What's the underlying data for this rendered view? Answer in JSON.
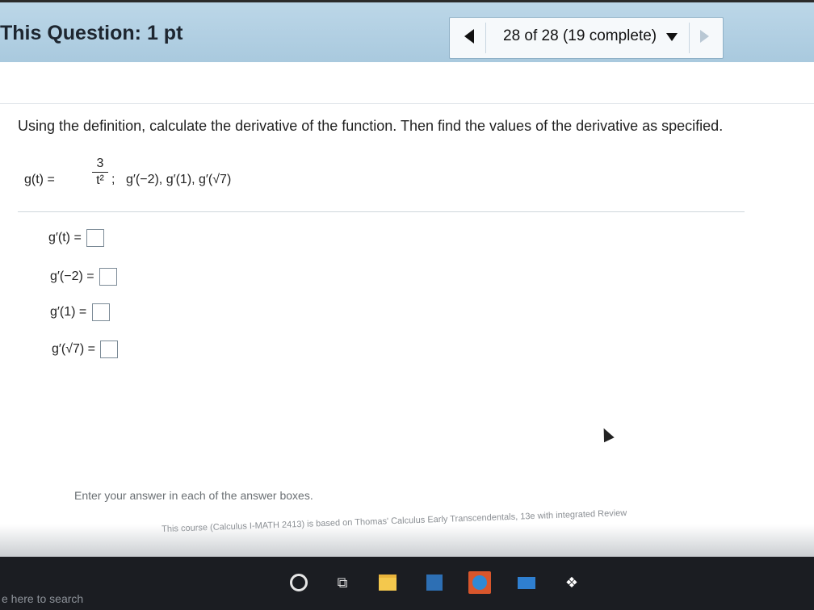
{
  "header": {
    "question_points": "This Question: 1 pt",
    "nav_status": "28 of 28 (19 complete)",
    "prev_icon": "triangle-left",
    "next_icon": "triangle-right",
    "dropdown_icon": "triangle-down"
  },
  "question": {
    "instruction": "Using the definition, calculate the derivative of the function. Then find the values of the derivative as specified.",
    "function_lhs": "g(t) =",
    "fraction_numerator": "3",
    "fraction_denominator": "t²",
    "semicolon": ";",
    "evaluations": "g′(−2), g′(1), g′(√7)"
  },
  "answers": [
    {
      "label": "g′(t) ="
    },
    {
      "label": "g′(−2) ="
    },
    {
      "label": "g′(1) ="
    },
    {
      "label": "g′(√7) ="
    }
  ],
  "footer": {
    "note": "Enter your answer in each of the answer boxes.",
    "course_text": "This course (Calculus I-MATH 2413) is based on Thomas' Calculus Early Transcendentals, 13e with integrated Review"
  },
  "taskbar": {
    "search_placeholder": "e here to search",
    "icons": [
      "cortana-icon",
      "task-view-icon",
      "file-explorer-icon",
      "store-icon",
      "edge-icon",
      "mail-icon",
      "dropbox-icon"
    ]
  }
}
